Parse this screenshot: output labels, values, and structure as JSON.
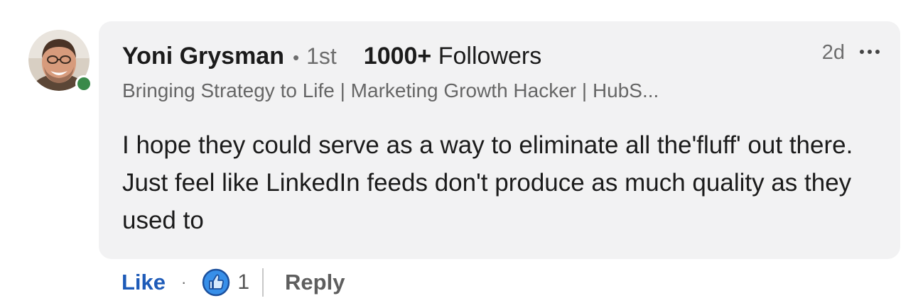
{
  "comment": {
    "author_name": "Yoni Grysman",
    "separator": "•",
    "connection_degree": "1st",
    "followers_count": "1000+",
    "followers_label": "Followers",
    "headline": "Bringing Strategy to Life | Marketing Growth Hacker | HubS...",
    "timestamp": "2d",
    "text": "I hope they could serve as a way to eliminate all the'fluff' out there. Just feel like LinkedIn feeds don't produce as much quality as they used to",
    "presence_status": "online"
  },
  "actions": {
    "like_label": "Like",
    "separator": "·",
    "reaction_icon": "thumbs-up-icon",
    "reaction_count": "1",
    "reply_label": "Reply"
  },
  "colors": {
    "bubble_background": "#f2f2f3",
    "like_blue": "#1e5bb8",
    "presence_green": "#3a8a4a",
    "reaction_blue": "#378fe9"
  }
}
